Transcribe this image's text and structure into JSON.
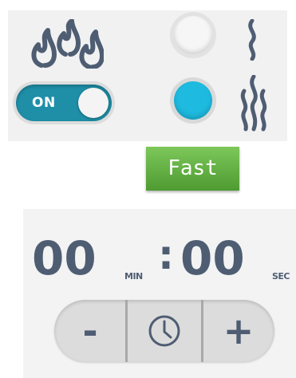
{
  "heat": {
    "icon": "flames-icon",
    "toggle_label": "ON",
    "toggle_state": "on"
  },
  "steam": {
    "slow_icon": "single-steam-icon",
    "fast_icon": "triple-steam-icon",
    "selected": "fast"
  },
  "fast_button": {
    "label": "Fast"
  },
  "timer": {
    "minutes": "00",
    "minutes_unit": "MIN",
    "separator": ":",
    "seconds": "00",
    "seconds_unit": "SEC"
  },
  "stepper": {
    "minus_label": "-",
    "plus_label": "+",
    "center_icon": "clock-icon"
  },
  "colors": {
    "toggle_on": "#1f8fa8",
    "radio_selected": "#1ebadf",
    "fast_button": "#5fae3d",
    "icon_gray": "#4f5d73",
    "timer_text": "#4f5d73"
  }
}
